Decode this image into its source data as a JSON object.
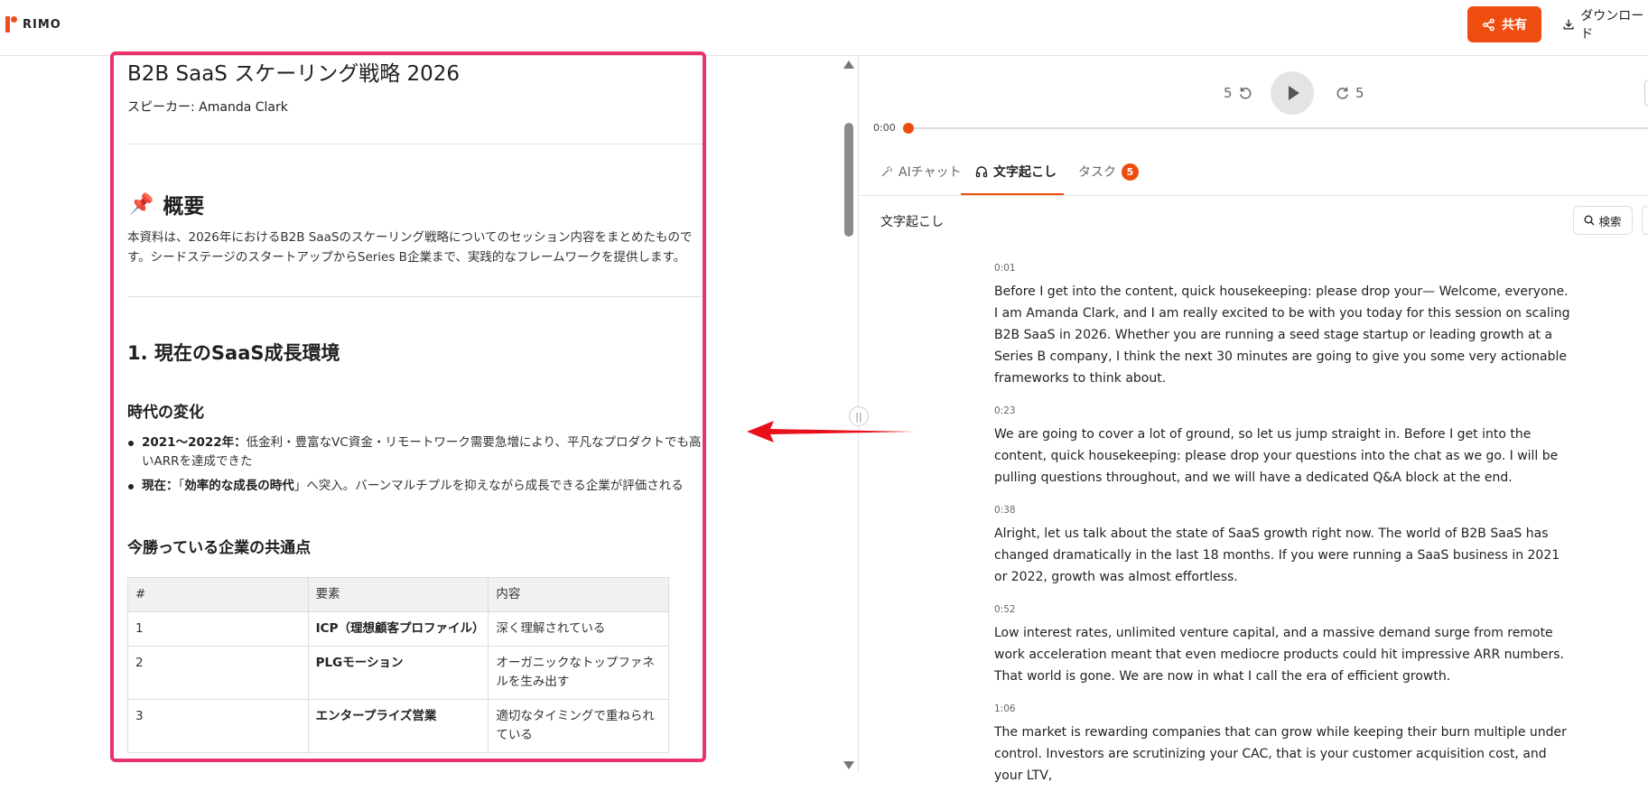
{
  "header": {
    "logo_text": "RIMO",
    "share_label": "共有",
    "download_label": "ダウンロード"
  },
  "document": {
    "title": "B2B SaaS スケーリング戦略 2026",
    "speaker": "スピーカー: Amanda Clark",
    "overview_heading": "概要",
    "overview_text": "本資料は、2026年におけるB2B SaaSのスケーリング戦略についてのセッション内容をまとめたものです。シードステージのスタートアップからSeries B企業まで、実践的なフレームワークを提供します。",
    "section1_heading": "1. 現在のSaaS成長環境",
    "sub1_heading": "時代の変化",
    "bullets": [
      {
        "label": "2021〜2022年：",
        "text": "低金利・豊富なVC資金・リモートワーク需要急増により、平凡なプロダクトでも高いARRを達成できた"
      },
      {
        "label": "現在：",
        "text_pre": "「",
        "bold": "効率的な成長の時代",
        "text_post": "」へ突入。バーンマルチプルを抑えながら成長できる企業が評価される"
      }
    ],
    "sub2_heading": "今勝っている企業の共通点",
    "table": {
      "headers": [
        "#",
        "要素",
        "内容"
      ],
      "rows": [
        [
          "1",
          "ICP（理想顧客プロファイル）",
          "深く理解されている"
        ],
        [
          "2",
          "PLGモーション",
          "オーガニックなトップファネルを生み出す"
        ],
        [
          "3",
          "エンタープライズ営業",
          "適切なタイミングで重ねられている"
        ]
      ]
    }
  },
  "player": {
    "skip_back": "5",
    "skip_forward": "5",
    "current_time": "0:00"
  },
  "tabs": [
    {
      "label": "AIチャット"
    },
    {
      "label": "文字起こし",
      "active": true
    },
    {
      "label": "タスク",
      "badge": "5"
    }
  ],
  "transcript": {
    "section_label": "文字起こし",
    "search_label": "検索",
    "segments": [
      {
        "time": "0:01",
        "text": "Before I get into the content, quick housekeeping: please drop your— Welcome, everyone. I am Amanda Clark, and I am really excited to be with you today for this session on scaling B2B SaaS in 2026. Whether you are running a seed stage startup or leading growth at a Series B company, I think the next 30 minutes are going to give you some very actionable frameworks to think about."
      },
      {
        "time": "0:23",
        "text": " We are going to cover a lot of ground, so let us jump straight in. Before I get into the content, quick housekeeping: please drop your questions into the chat as we go. I will be pulling questions throughout, and we will have a dedicated Q&A block at the end."
      },
      {
        "time": "0:38",
        "text": " Alright, let us talk about the state of SaaS growth right now. The world of B2B SaaS has changed dramatically in the last 18 months. If you were running a SaaS business in 2021 or 2022, growth was almost effortless."
      },
      {
        "time": "0:52",
        "text": " Low interest rates, unlimited venture capital, and a massive demand surge from remote work acceleration meant that even mediocre products could hit impressive ARR numbers. That world is gone. We are now in what I call the era of efficient growth."
      },
      {
        "time": "1:06",
        "text": " The market is rewarding companies that can grow while keeping their burn multiple under control. Investors are scrutinizing your CAC, that is your customer acquisition cost, and your LTV,"
      }
    ]
  },
  "colors": {
    "accent": "#ee4d0f",
    "highlight_border": "#e8336b",
    "arrow": "#e8101a"
  }
}
